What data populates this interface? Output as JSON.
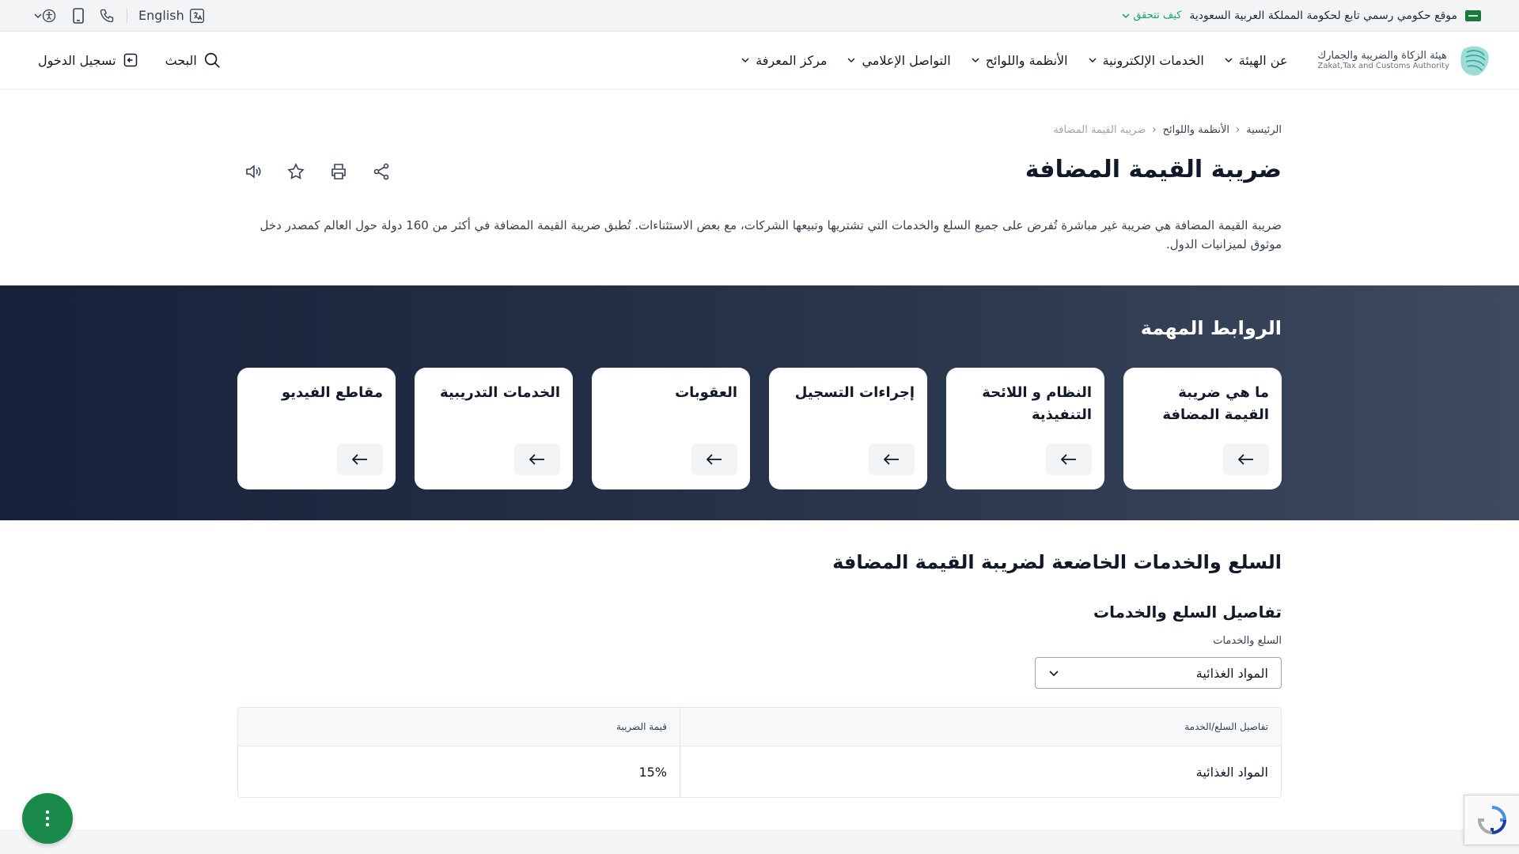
{
  "gov_bar": {
    "official_text": "موقع حكومي رسمي تابع لحكومة المملكة العربية السعودية",
    "how_to_verify": "كيف تتحقق"
  },
  "utilities": {
    "language": "English"
  },
  "brand": {
    "name_ar": "هيئة الزكاة والضريبة والجمارك",
    "name_en": "Zakat,Tax and Customs Authority"
  },
  "nav": {
    "items": [
      {
        "label": "عن الهيئة"
      },
      {
        "label": "الخدمات الإلكترونية"
      },
      {
        "label": "الأنظمة واللوائح"
      },
      {
        "label": "التواصل الإعلامي"
      },
      {
        "label": "مركز المعرفة"
      }
    ],
    "search": "البحث",
    "login": "تسجيل الدخول"
  },
  "breadcrumb": {
    "home": "الرئيسية",
    "regs": "الأنظمة واللوائح",
    "current": "ضريبة القيمة المضافة"
  },
  "page": {
    "title": "ضريبة القيمة المضافة",
    "description": "ضريبة القيمة المضافة هي ضريبة غير مباشرة تُفرض على جميع السلع والخدمات التي تشتريها وتبيعها الشركات، مع بعض الاستثناءات. تُطبق ضريبة القيمة المضافة في أكثر من 160 دولة حول العالم كمصدر دخل موثوق لميزانيات الدول."
  },
  "important_links": {
    "title": "الروابط المهمة",
    "cards": [
      {
        "title": "ما هي ضريبة القيمة المضافة"
      },
      {
        "title": "النظام و اللائحة التنفيذية"
      },
      {
        "title": "إجراءات التسجيل"
      },
      {
        "title": "العقوبات"
      },
      {
        "title": "الخدمات التدريبية"
      },
      {
        "title": "مقاطع الفيديو"
      }
    ]
  },
  "goods": {
    "section_title": "السلع والخدمات الخاضعة لضريبة القيمة المضافة",
    "subtitle": "تفاصيل السلع والخدمات",
    "field_label": "السلع والخدمات",
    "selected": "المواد الغذائية",
    "table": {
      "headers": [
        "تفاصيل السلع/الخدمة",
        "قيمة الضريبة"
      ],
      "rows": [
        [
          "المواد الغذائية",
          "15%"
        ]
      ]
    }
  },
  "colors": {
    "primary_green": "#1a8a4a",
    "verify_link": "#18a06a",
    "links_bg_dark": "#17213a"
  }
}
